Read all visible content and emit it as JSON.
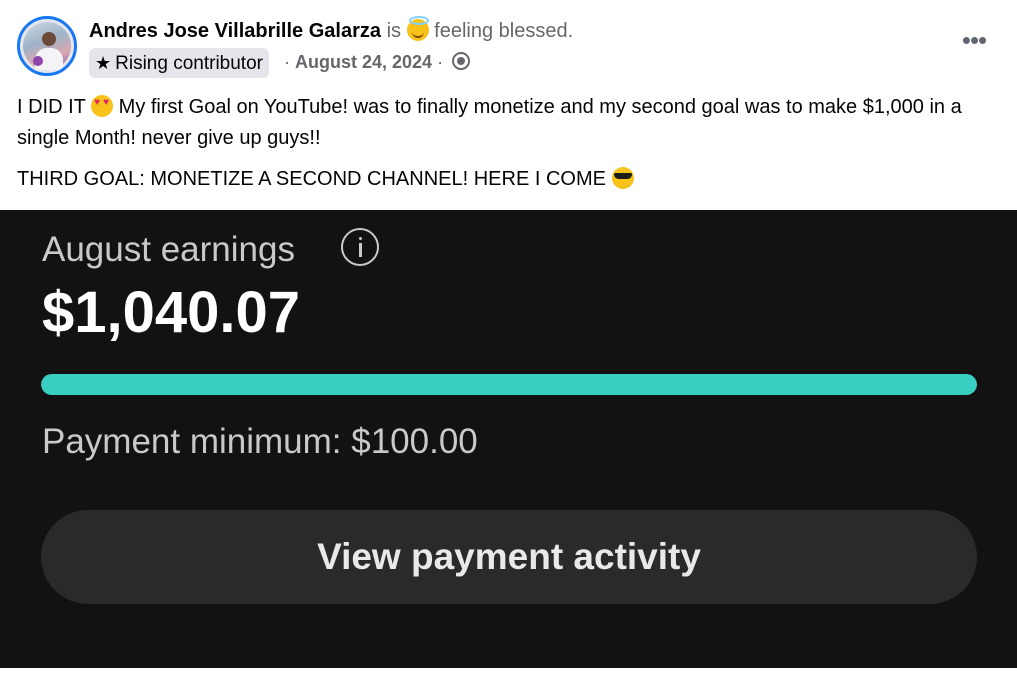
{
  "post": {
    "author": "Andres Jose Villabrille Galarza",
    "status_verb": "is",
    "feeling_icon": "smiling-face-with-halo",
    "feeling_text": "feeling blessed.",
    "badge_icon": "star",
    "badge": "Rising contributor",
    "date_prefix": "·",
    "date": "August 24, 2024",
    "date_suffix": "·",
    "audience_icon": "globe-icon",
    "more_label": "•••",
    "line1_a": "I DID IT",
    "line1_emoji": "smiling-face-with-heart-eyes",
    "line1_b": "My first Goal on YouTube! was to finally monetize and my second goal was to make $1,000 in a single Month! never give up guys!!",
    "line2": "THIRD GOAL: MONETIZE A SECOND CHANNEL! HERE I COME",
    "line2_emoji": "smiling-face-with-sunglasses"
  },
  "earnings": {
    "title": "August earnings",
    "amount": "$1,040.07",
    "progress_fraction": 1.0,
    "progress_color": "#37cfc2",
    "minimum": "Payment minimum: $100.00",
    "button": "View payment activity"
  }
}
